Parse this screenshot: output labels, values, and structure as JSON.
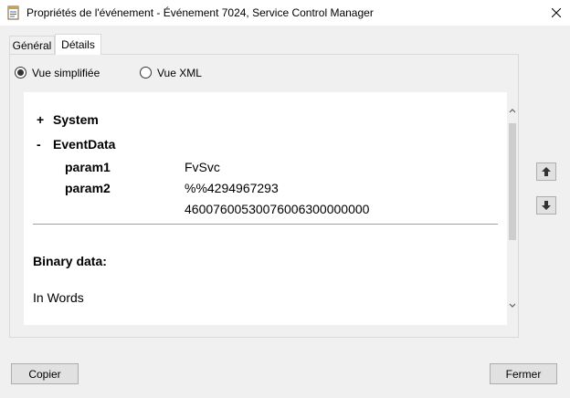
{
  "window": {
    "title": "Propriétés de l'événement - Événement 7024, Service Control Manager",
    "icons": {
      "app": "event-properties-icon",
      "close": "close-icon"
    }
  },
  "tabs": [
    {
      "label": "Général",
      "selected": false
    },
    {
      "label": "Détails",
      "selected": true
    }
  ],
  "view_options": [
    {
      "label": "Vue simplifiée",
      "selected": true
    },
    {
      "label": "Vue XML",
      "selected": false
    }
  ],
  "details": {
    "system": {
      "toggle": "+",
      "label": "System"
    },
    "eventdata": {
      "toggle": "-",
      "label": "EventData"
    },
    "params": [
      {
        "name": "param1",
        "value": "FvSvc"
      },
      {
        "name": "param2",
        "value": "%%4294967293"
      }
    ],
    "extra_value": "46007600530076006300000000",
    "binary_heading": "Binary data:",
    "binary_format": "In Words"
  },
  "buttons": {
    "copy": "Copier",
    "close": "Fermer"
  },
  "side_nav": {
    "up_icon": "arrow-up-icon",
    "down_icon": "arrow-down-icon"
  }
}
